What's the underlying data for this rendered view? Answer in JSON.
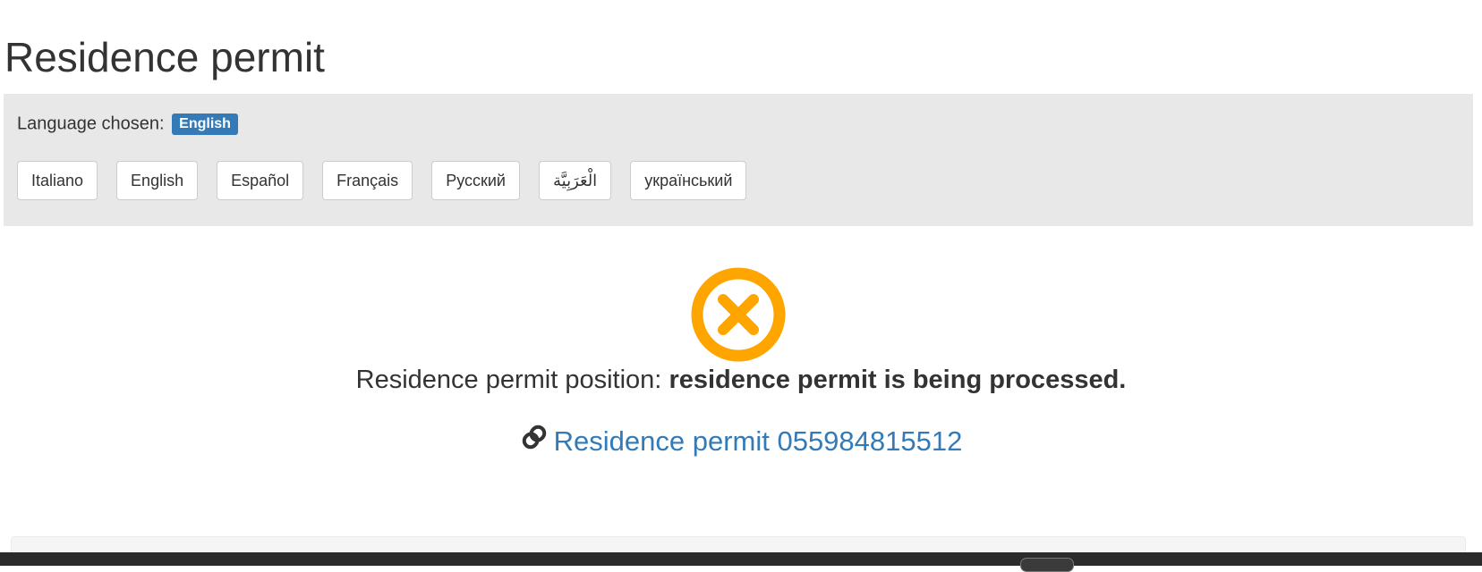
{
  "page": {
    "title": "Residence permit"
  },
  "language_panel": {
    "chosen_label": "Language chosen:",
    "chosen_value": "English",
    "options": [
      {
        "label": "Italiano"
      },
      {
        "label": "English"
      },
      {
        "label": "Español"
      },
      {
        "label": "Français"
      },
      {
        "label": "Русский"
      },
      {
        "label": "الْعَرَبِيَّة"
      },
      {
        "label": "український"
      }
    ]
  },
  "status": {
    "icon": "x-circle-icon",
    "icon_color": "#ffa500",
    "prefix": "Residence permit position:",
    "value": "residence permit is being processed."
  },
  "permit_link": {
    "icon": "link-icon",
    "label": "Residence permit 055984815512",
    "color": "#337ab7"
  }
}
